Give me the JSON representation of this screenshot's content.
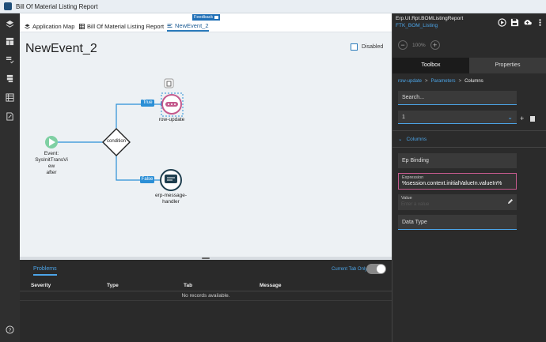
{
  "window": {
    "title": "Bill Of Material Listing Report"
  },
  "tabs": [
    {
      "label": "Application Map"
    },
    {
      "label": "Bill Of Material Listing Report"
    },
    {
      "label": "NewEvent_2"
    }
  ],
  "feedback": {
    "label": "Feedback"
  },
  "canvas": {
    "title": "NewEvent_2",
    "disabled_label": "Disabled",
    "nodes": {
      "start_label_lines": [
        "Event:",
        "SysInitTransVi",
        "ew",
        "after"
      ],
      "condition_label": "condition",
      "true_label": "True",
      "false_label": "False",
      "row_update_label": "row-update",
      "handler_label_lines": [
        "erp-message-",
        "handler"
      ]
    }
  },
  "problems": {
    "tab_label": "Problems",
    "current_tab_only_label": "Current Tab Only",
    "columns": [
      "Severity",
      "Type",
      "Tab",
      "Message"
    ],
    "empty_message": "No records available."
  },
  "right_panel": {
    "header_title": "Erp.UI.Rpt.BOMListingReport",
    "header_subtitle": "FTK_BOM_Listing",
    "zoom_value": "100%",
    "tabs": [
      "Toolbox",
      "Properties"
    ],
    "breadcrumb": [
      "row-update",
      "Parameters",
      "Columns"
    ],
    "search_placeholder": "Search...",
    "select_value": "1",
    "section_label": "Columns",
    "ep_binding_label": "Ep Binding",
    "expression_label": "Expression",
    "expression_value": "%session.context.initialValueIn.valueIn%",
    "value_label": "Value",
    "value_placeholder": "Enter a value",
    "data_type_label": "Data Type"
  },
  "colors": {
    "accent": "#2b7bbb",
    "start_node": "#7fd0a3",
    "row_update_ring": "#c45a8d",
    "handler_node": "#1f3f4f"
  }
}
